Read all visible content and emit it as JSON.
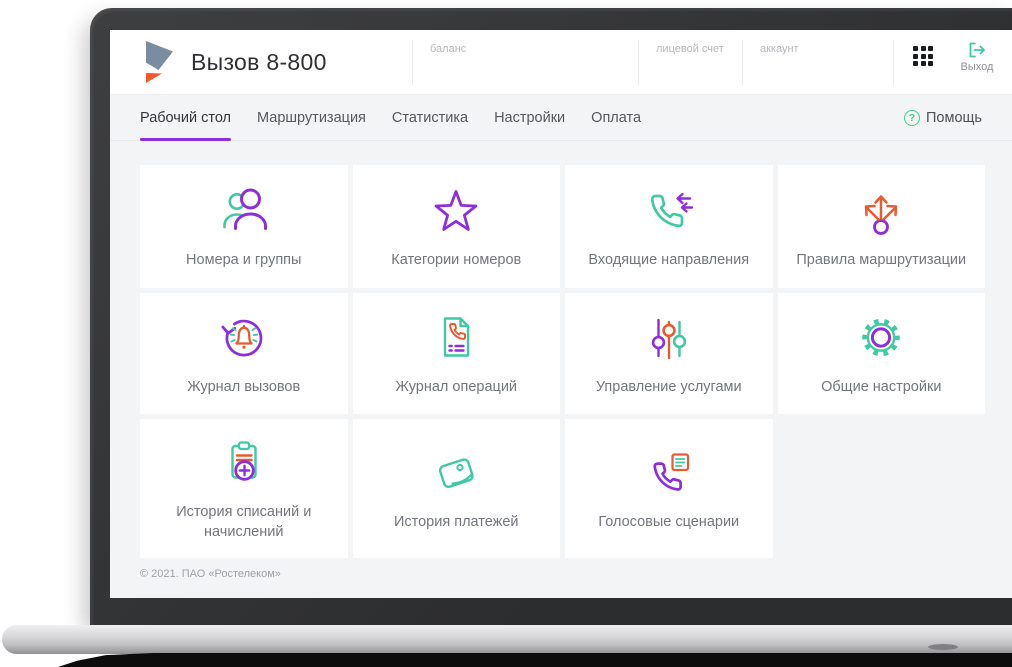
{
  "header": {
    "app_title": "Вызов 8-800",
    "balance_label": "баланс",
    "personal_account_label": "лицевой счет",
    "account_label": "аккаунт",
    "logout_label": "Выход"
  },
  "nav": {
    "tabs": [
      {
        "label": "Рабочий стол",
        "active": true
      },
      {
        "label": "Маршрутизация",
        "active": false
      },
      {
        "label": "Статистика",
        "active": false
      },
      {
        "label": "Настройки",
        "active": false
      },
      {
        "label": "Оплата",
        "active": false
      }
    ],
    "help_label": "Помощь",
    "help_glyph": "?"
  },
  "cards": [
    {
      "label": "Номера и группы",
      "icon": "users-icon"
    },
    {
      "label": "Категории номеров",
      "icon": "star-icon"
    },
    {
      "label": "Входящие направления",
      "icon": "incoming-call-icon"
    },
    {
      "label": "Правила маршрутизации",
      "icon": "routing-arrows-icon"
    },
    {
      "label": "Журнал вызовов",
      "icon": "call-log-bell-icon"
    },
    {
      "label": "Журнал операций",
      "icon": "operations-document-icon"
    },
    {
      "label": "Управление услугами",
      "icon": "sliders-icon"
    },
    {
      "label": "Общие настройки",
      "icon": "gear-icon"
    },
    {
      "label": "История списаний и начислений",
      "icon": "clipboard-plus-icon"
    },
    {
      "label": "История платежей",
      "icon": "wallet-icon"
    },
    {
      "label": "Голосовые сценарии",
      "icon": "voice-script-icon"
    }
  ],
  "footer": {
    "copyright": "© 2021. ПАО «Ростелеком»"
  },
  "colors": {
    "purple": "#8e2edb",
    "teal": "#3fc9a5",
    "orange": "#e85a32",
    "green": "#3ecf8e",
    "brand-gray": "#7a8da0",
    "brand-orange": "#f0582a"
  }
}
